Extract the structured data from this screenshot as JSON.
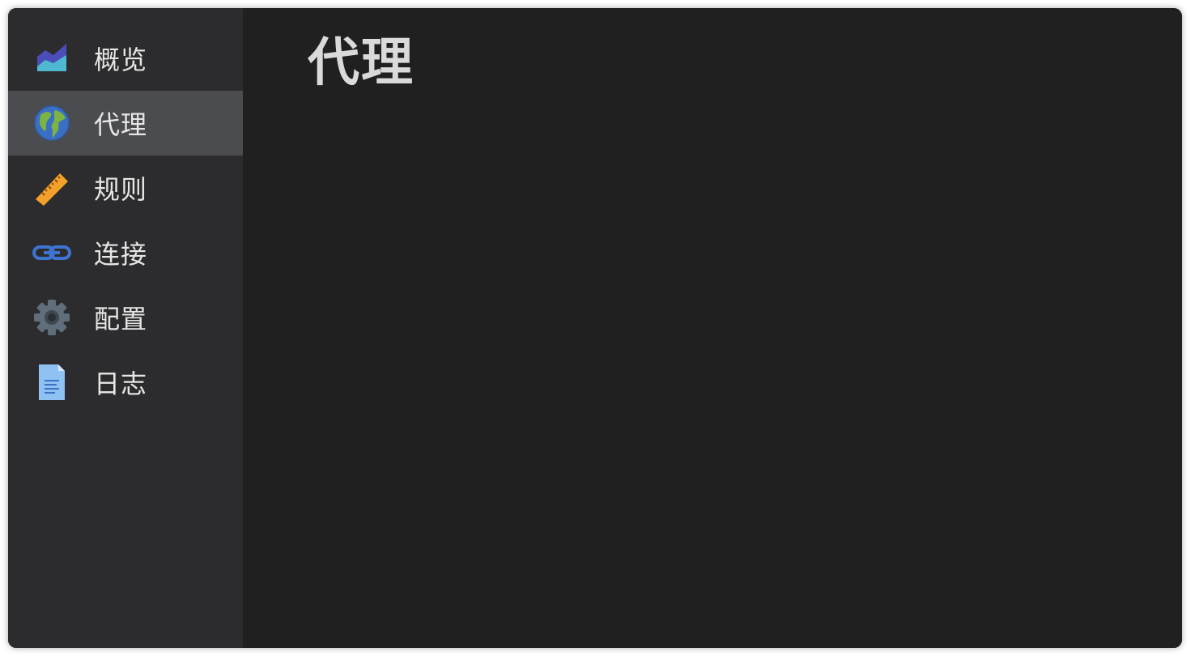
{
  "sidebar": {
    "items": [
      {
        "label": "概览",
        "icon": "area-chart-icon",
        "active": false
      },
      {
        "label": "代理",
        "icon": "globe-icon",
        "active": true
      },
      {
        "label": "规则",
        "icon": "ruler-icon",
        "active": false
      },
      {
        "label": "连接",
        "icon": "link-icon",
        "active": false
      },
      {
        "label": "配置",
        "icon": "gear-icon",
        "active": false
      },
      {
        "label": "日志",
        "icon": "document-icon",
        "active": false
      }
    ]
  },
  "main": {
    "title": "代理"
  },
  "colors": {
    "window_bg": "#202020",
    "sidebar_bg": "#2c2c2e",
    "active_item_bg": "#4b4c50",
    "text": "#e6e6e6"
  }
}
